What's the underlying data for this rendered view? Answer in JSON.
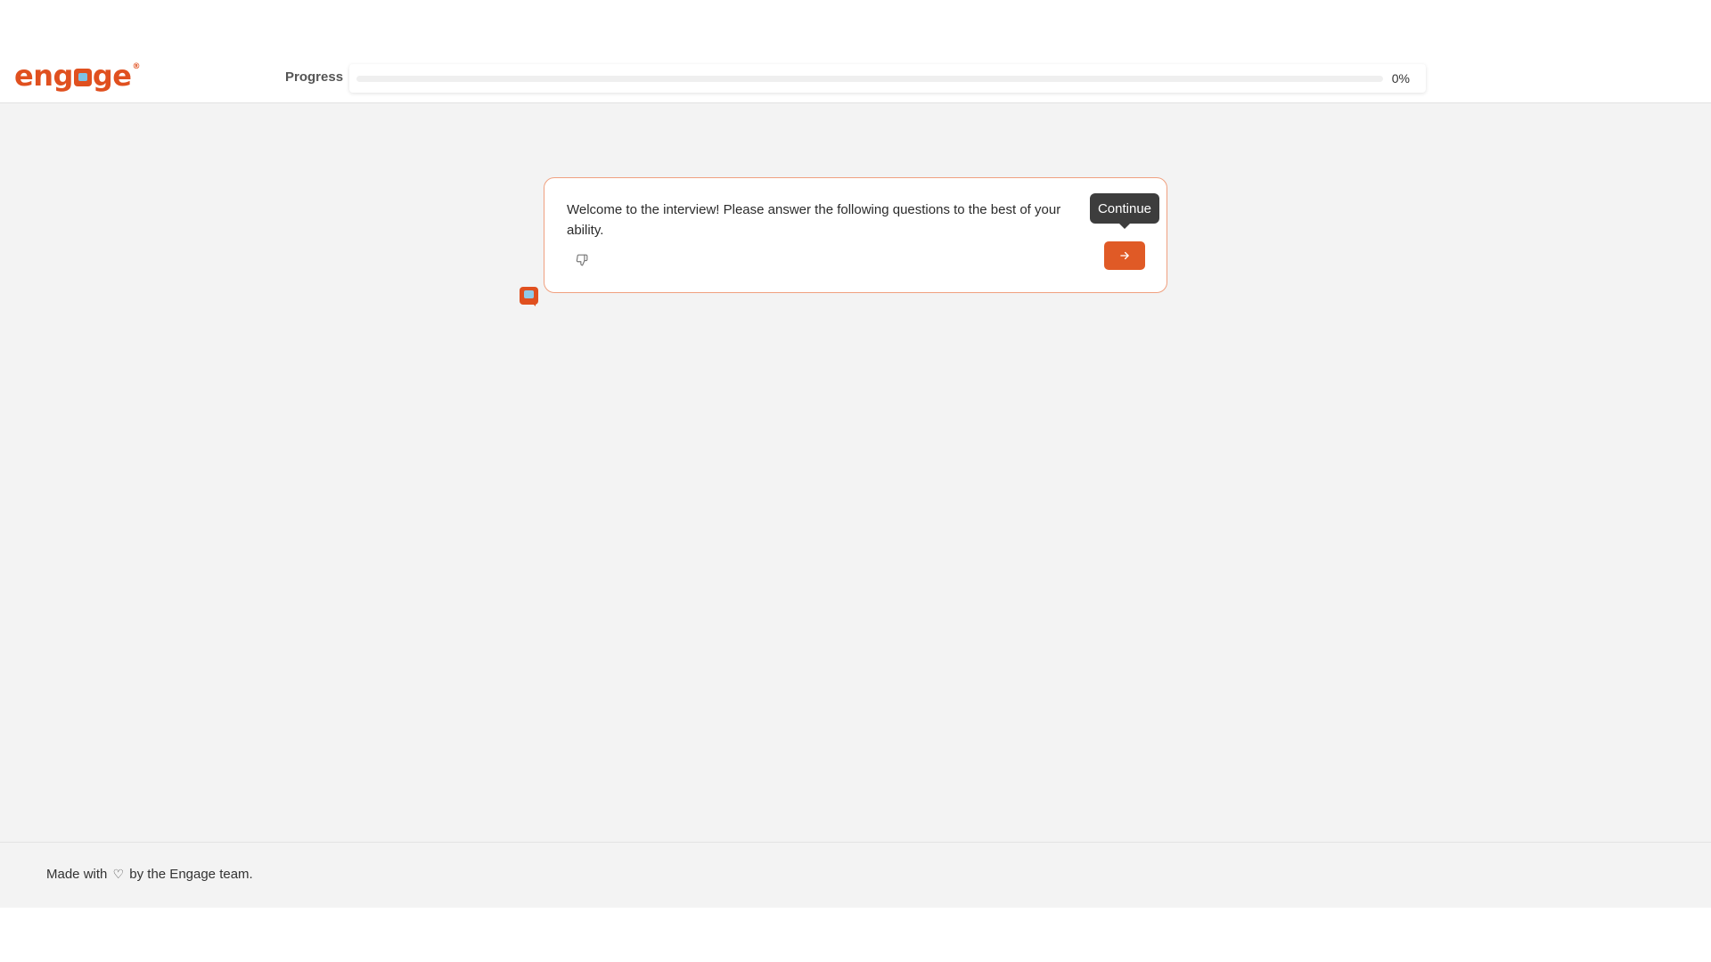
{
  "header": {
    "logo": {
      "pre": "eng",
      "mid": "",
      "post": "ge",
      "reg": "®"
    },
    "progress_label": "Progress",
    "progress_value_text": "0%",
    "progress_fraction": 0
  },
  "card": {
    "message": "Welcome to the interview! Please answer the following questions to the best of your ability.",
    "dislike_icon": "thumbs-down-icon",
    "continue_tooltip": "Continue",
    "continue_icon": "arrow-right-icon"
  },
  "footer": {
    "text_before": "Made with",
    "heart_icon": "heart-icon",
    "text_after": "by the Engage team."
  },
  "colors": {
    "brand": "#e0501f",
    "card_border": "#f0a07f",
    "tooltip_bg": "#3d3d3d",
    "page_bg": "#f3f3f3"
  }
}
